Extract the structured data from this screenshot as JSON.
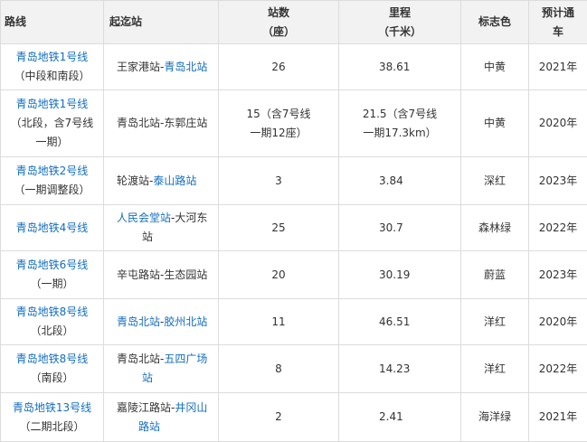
{
  "header": {
    "route": "路线",
    "stations": "起迄站",
    "stops_line1": "站数",
    "stops_line2": "（座）",
    "length_line1": "里程",
    "length_line2": "（千米）",
    "color": "标志色",
    "open_line1": "预计通",
    "open_line2": "车"
  },
  "rows": [
    {
      "route": "青岛地铁1号线",
      "route_sub": "（中段和南段）",
      "station_a": "王家港站",
      "sep": "-",
      "station_b": "青岛北站",
      "stops": "26",
      "length": "38.61",
      "color": "中黄",
      "open": "2021年"
    },
    {
      "route_line1": "青岛地铁1号线",
      "route_line2": "（北段，含7号线",
      "route_line3": "一期）",
      "stations_text": "青岛北站-东郭庄站",
      "stops_line1": "15（含7号线",
      "stops_line2": "一期12座）",
      "length_line1": "21.5（含7号线",
      "length_line2": "一期17.3km）",
      "color": "中黄",
      "open": "2020年"
    },
    {
      "route": "青岛地铁2号线",
      "route_sub": "（一期调整段）",
      "station_a": "轮渡站",
      "sep": "-",
      "station_b": "泰山路站",
      "stops": "3",
      "length": "3.84",
      "color": "深红",
      "open": "2023年"
    },
    {
      "route": "青岛地铁4号线",
      "station_a": "人民会堂站",
      "sep": "-大河东",
      "station_b_line2": "站",
      "stops": "25",
      "length": "30.7",
      "color": "森林绿",
      "open": "2022年"
    },
    {
      "route": "青岛地铁6号线",
      "route_sub": "（一期）",
      "stations_text": "辛屯路站-生态园站",
      "stops": "20",
      "length": "30.19",
      "color": "蔚蓝",
      "open": "2023年"
    },
    {
      "route": "青岛地铁8号线",
      "route_sub": "（北段）",
      "station_a": "青岛北站",
      "sep": "-",
      "station_b": "胶州北站",
      "stops": "11",
      "length": "46.51",
      "color": "洋红",
      "open": "2020年"
    },
    {
      "route": "青岛地铁8号线",
      "route_sub": "（南段）",
      "station_a_plain": "青岛北站-",
      "station_b": "五四广场",
      "station_b_line2": "站",
      "stops": "8",
      "length": "14.23",
      "color": "洋红",
      "open": "2022年"
    },
    {
      "route": "青岛地铁13号线",
      "route_sub": "（二期北段）",
      "station_a_plain": "嘉陵江路站-",
      "station_b": "井冈山",
      "station_b_line2": "路站",
      "stops": "2",
      "length": "2.41",
      "color": "海洋绿",
      "open": "2021年"
    }
  ]
}
